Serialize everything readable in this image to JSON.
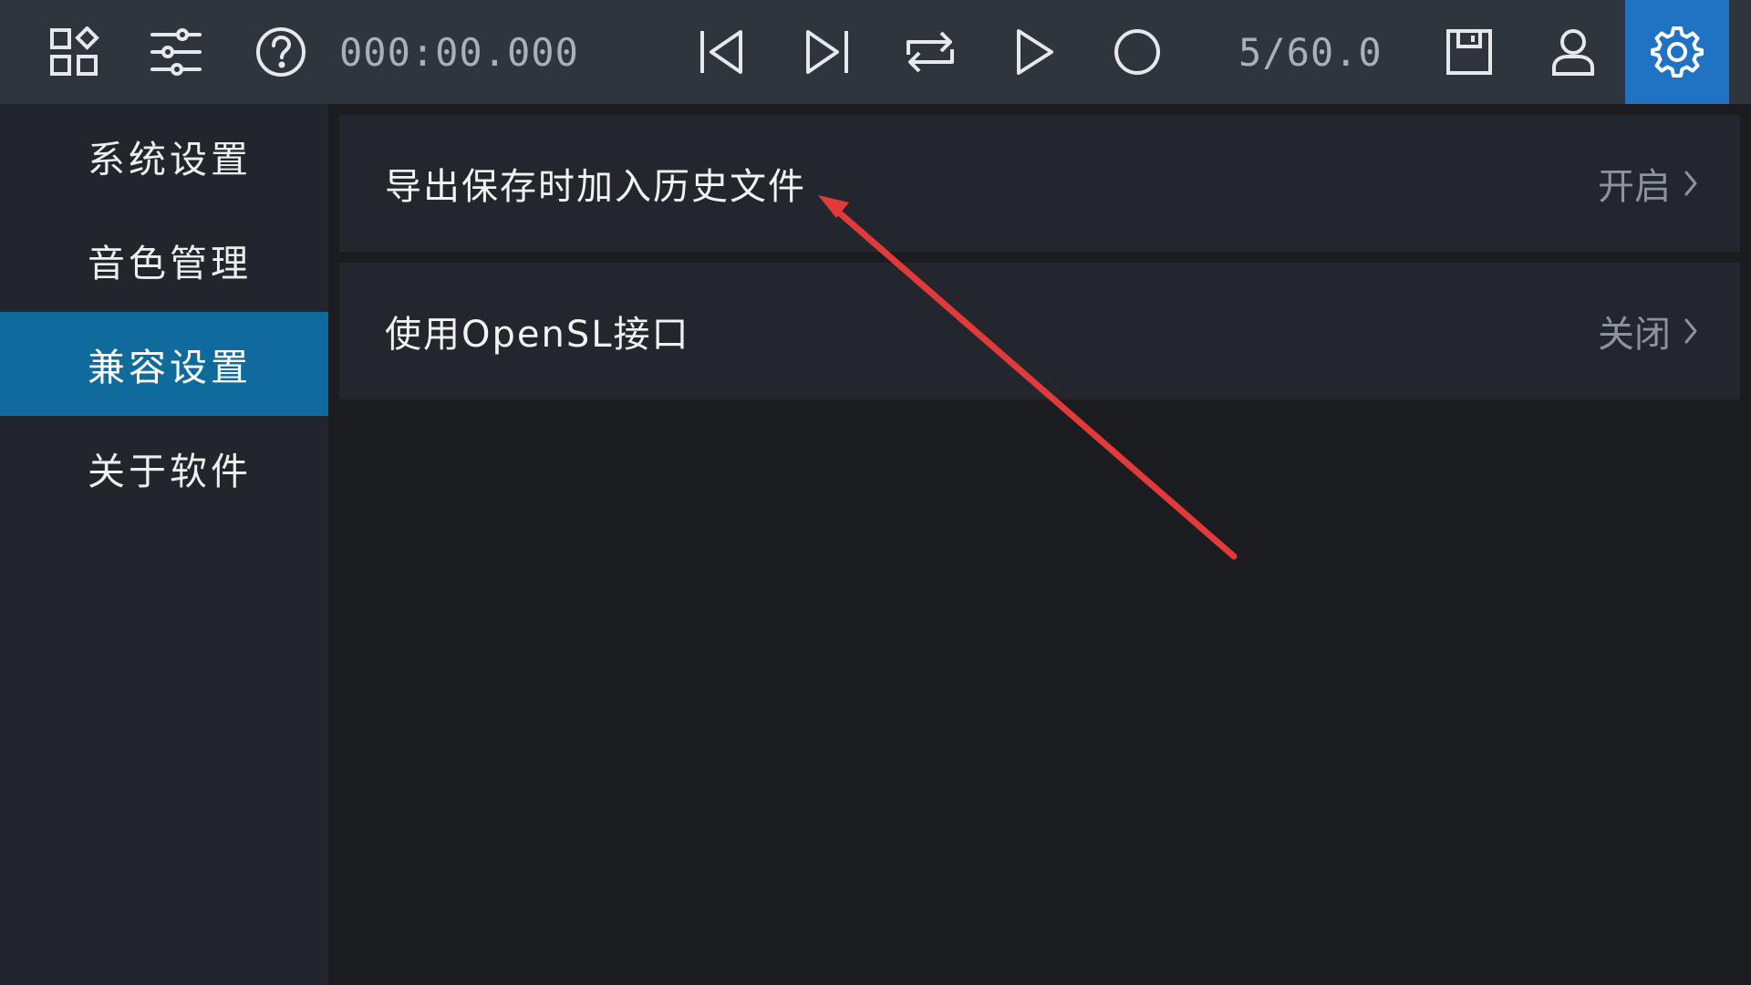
{
  "toolbar": {
    "time": "000:00.000",
    "counter": "5/60.0",
    "icons": {
      "apps": "apps-grid-icon",
      "mixer": "sliders-icon",
      "help": "help-icon",
      "prev": "skip-previous-icon",
      "next": "skip-next-icon",
      "loop": "repeat-icon",
      "play": "play-icon",
      "record": "record-icon",
      "save": "save-icon",
      "user": "user-icon",
      "settings": "gear-icon"
    }
  },
  "sidebar": {
    "items": [
      {
        "label": "系统设置",
        "active": false
      },
      {
        "label": "音色管理",
        "active": false
      },
      {
        "label": "兼容设置",
        "active": true
      },
      {
        "label": "关于软件",
        "active": false
      }
    ]
  },
  "main": {
    "settings": [
      {
        "label": "导出保存时加入历史文件",
        "value": "开启"
      },
      {
        "label": "使用OpenSL接口",
        "value": "关闭"
      }
    ]
  },
  "colors": {
    "toolbar_bg": "#2f353d",
    "settings_active_bg": "#1f73c2",
    "sidebar_active_bg": "#0f6b9c",
    "annotation_arrow": "#e23a3a"
  }
}
